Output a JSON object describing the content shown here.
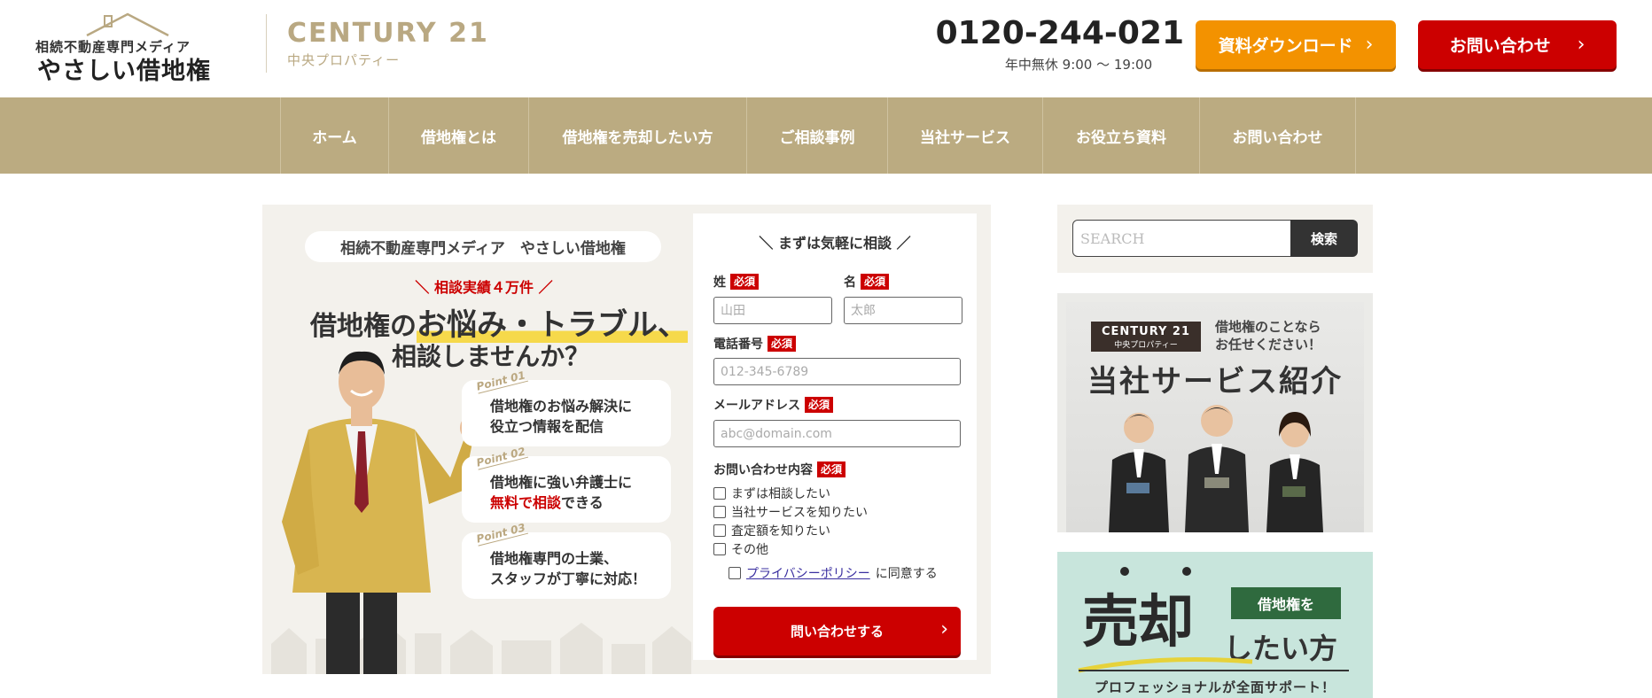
{
  "header": {
    "logo_tagline": "相続不動産専門メディア",
    "logo_name": "やさしい借地権",
    "brand_name": "CENTURY 21",
    "brand_sub": "中央プロパティー",
    "phone_number": "0120-244-021",
    "phone_hours": "年中無休 9:00 〜 19:00",
    "download_label": "資料ダウンロード",
    "contact_label": "お問い合わせ",
    "colors": {
      "gold": "#bbab81",
      "orange": "#f39200",
      "red": "#cc0000"
    }
  },
  "nav": {
    "items": [
      {
        "label": "ホーム"
      },
      {
        "label": "借地権とは"
      },
      {
        "label": "借地権を売却したい方"
      },
      {
        "label": "ご相談事例"
      },
      {
        "label": "当社サービス"
      },
      {
        "label": "お役立ち資料"
      },
      {
        "label": "お問い合わせ"
      }
    ]
  },
  "hero": {
    "media_pill": "相続不動産専門メディア　やさしい借地権",
    "record": "＼ 相談実績４万件 ／",
    "headline_pre": "借地権の",
    "headline_big": "お悩み・トラブル、",
    "headline2": "相談しませんか？",
    "points": [
      {
        "tag": "Point 01",
        "line1": "借地権のお悩み解決に",
        "line2": "役立つ情報を配信"
      },
      {
        "tag": "Point 02",
        "line1": "借地権に強い弁護士に",
        "line2_red": "無料で相談",
        "line2_rest": "できる"
      },
      {
        "tag": "Point 03",
        "line1": "借地権専門の士業、",
        "line2": "スタッフが丁寧に対応！"
      }
    ]
  },
  "form": {
    "title": "＼ まずは気軽に相談 ／",
    "required": "必須",
    "last_name_label": "姓",
    "last_name_placeholder": "山田",
    "first_name_label": "名",
    "first_name_placeholder": "太郎",
    "phone_label": "電話番号",
    "phone_placeholder": "012-345-6789",
    "email_label": "メールアドレス",
    "email_placeholder": "abc@domain.com",
    "inquiry_label": "お問い合わせ内容",
    "options": [
      {
        "label": "まずは相談したい"
      },
      {
        "label": "当社サービスを知りたい"
      },
      {
        "label": "査定額を知りたい"
      },
      {
        "label": "その他"
      }
    ],
    "privacy_link": "プライバシーポリシー",
    "privacy_suffix": "に同意する",
    "submit_label": "問い合わせする"
  },
  "sidebar": {
    "search_placeholder": "SEARCH",
    "search_button": "検索",
    "service_banner": {
      "badge_name": "CENTURY 21",
      "badge_sub": "中央プロパティー",
      "sub_line1": "借地権のことなら",
      "sub_line2": "お任せください！",
      "title": "当社サービス紹介"
    },
    "sell_banner": {
      "big": "売却",
      "tag": "借地権を",
      "rest": "したい方",
      "foot": "プロフェッショナルが全面サポート！"
    }
  }
}
